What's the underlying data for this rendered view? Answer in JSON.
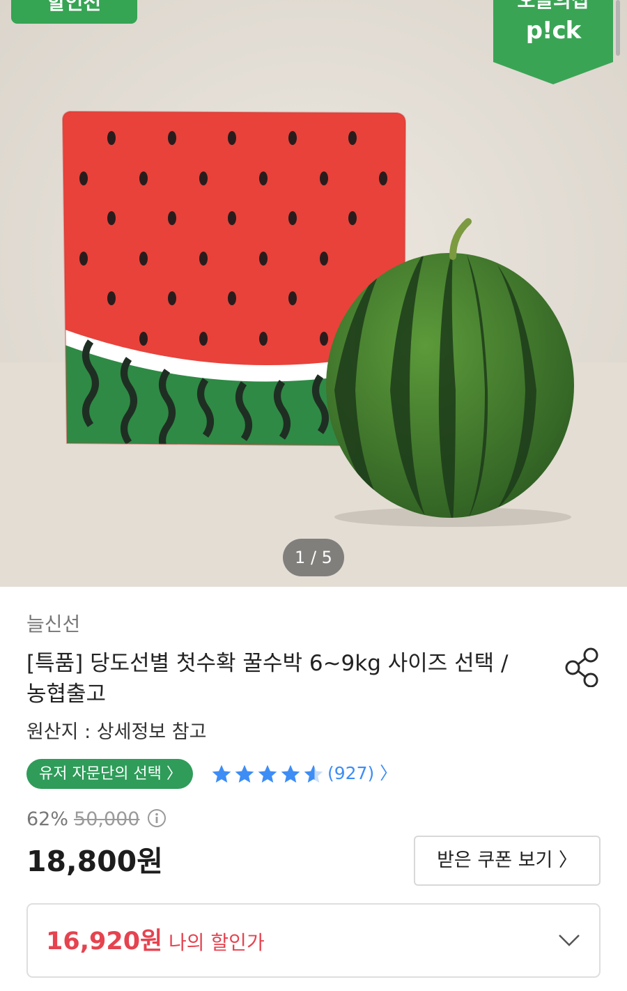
{
  "hero": {
    "badge_left": "할인전",
    "pick_top": "오늘의집",
    "pick_bottom": "p!ck",
    "pager": "1 / 5"
  },
  "product": {
    "seller": "늘신선",
    "title": "[특품] 당도선별  첫수확 꿀수박 6~9kg 사이즈 선택 / 농협출고",
    "origin": "원산지 : 상세정보 참고",
    "advisor_chip": "유저 자문단의 선택 〉",
    "rating": 4.5,
    "review_count": "(927) 〉",
    "discount_rate": "62%",
    "original_price": "50,000",
    "price": "18,800원",
    "coupon_button": "받은 쿠폰 보기 〉",
    "my_price": "16,920원",
    "my_price_label": "나의 할인가"
  },
  "colors": {
    "brand_green": "#35a453",
    "star_blue": "#3d8df5",
    "sale_red": "#e5434f"
  },
  "icons": {
    "share": "share-icon",
    "info": "info-icon",
    "star": "star-icon",
    "chevron_down": "chevron-down-icon"
  }
}
